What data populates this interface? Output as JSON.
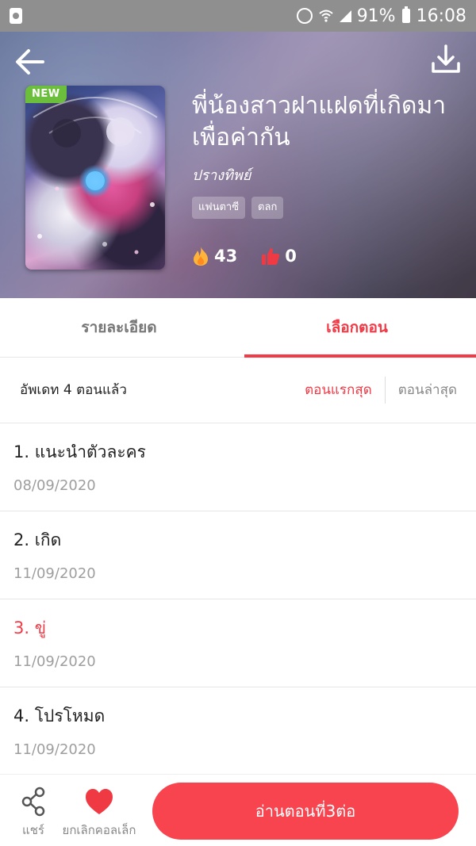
{
  "status_bar": {
    "battery": "91%",
    "time": "16:08"
  },
  "header": {
    "badge": "NEW",
    "title": "พี่น้องสาวฝาแฝดที่เกิดมาเพื่อค่ากัน",
    "author": "ปรางทิพย์",
    "tags": [
      "แฟนตาซี",
      "ตลก"
    ],
    "stats": {
      "fire_count": "43",
      "like_count": "0"
    }
  },
  "tabs": [
    {
      "label": "รายละเอียด",
      "active": false
    },
    {
      "label": "เลือกตอน",
      "active": true
    }
  ],
  "update_bar": {
    "text": "อัพเดท 4 ตอนแล้ว",
    "sort_first": "ตอนแรกสุด",
    "sort_latest": "ตอนล่าสุด"
  },
  "episodes": [
    {
      "title": "1. แนะนำตัวละคร",
      "date": "08/09/2020"
    },
    {
      "title": "2. เกิด",
      "date": "11/09/2020"
    },
    {
      "title": "3. ขู่",
      "date": "11/09/2020",
      "current": true
    },
    {
      "title": "4. โปรโหมด",
      "date": "11/09/2020"
    }
  ],
  "bottom_bar": {
    "share_label": "แชร์",
    "uncollect_label": "ยกเลิกคอลเล็ก",
    "read_button": "อ่านตอนที่3ต่อ"
  },
  "colors": {
    "accent": "#f23a46",
    "button": "#f8444f",
    "new_badge": "#6cbf3c",
    "status_bar": "#8f8f8f"
  },
  "icons": [
    "back-arrow-icon",
    "download-icon",
    "fire-icon",
    "thumbs-up-icon",
    "share-icon",
    "heart-icon",
    "alarm-icon",
    "wifi-icon",
    "signal-icon",
    "battery-icon"
  ]
}
